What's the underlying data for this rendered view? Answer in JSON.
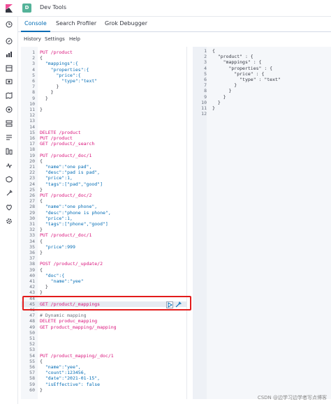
{
  "header": {
    "badge": "D",
    "title": "Dev Tools"
  },
  "tabs": [
    {
      "label": "Console"
    },
    {
      "label": "Search Profiler"
    },
    {
      "label": "Grok Debugger"
    }
  ],
  "toolbar": {
    "history": "History",
    "settings": "Settings",
    "help": "Help"
  },
  "editor_lines": [
    {
      "n": "1",
      "t": "PUT /product"
    },
    {
      "n": "2",
      "t": "{"
    },
    {
      "n": "3",
      "t": "  \"mappings\":{"
    },
    {
      "n": "4",
      "t": "    \"properties\":{"
    },
    {
      "n": "5",
      "t": "      \"price\":{"
    },
    {
      "n": "6",
      "t": "        \"type\":\"text\""
    },
    {
      "n": "7",
      "t": "      }"
    },
    {
      "n": "8",
      "t": "    }"
    },
    {
      "n": "9",
      "t": "  }"
    },
    {
      "n": "10",
      "t": ""
    },
    {
      "n": "11",
      "t": "}"
    },
    {
      "n": "12",
      "t": ""
    },
    {
      "n": "13",
      "t": ""
    },
    {
      "n": "14",
      "t": ""
    },
    {
      "n": "15",
      "t": "DELETE /product"
    },
    {
      "n": "16",
      "t": "PUT /product"
    },
    {
      "n": "17",
      "t": "GET /product/_search"
    },
    {
      "n": "18",
      "t": ""
    },
    {
      "n": "19",
      "t": "PUT /product/_doc/1"
    },
    {
      "n": "20",
      "t": "{"
    },
    {
      "n": "21",
      "t": "  \"name\":\"one pad\","
    },
    {
      "n": "22",
      "t": "  \"desc\":\"pad is pad\","
    },
    {
      "n": "23",
      "t": "  \"price\":1,"
    },
    {
      "n": "24",
      "t": "  \"tags\":[\"pad\",\"good\"]"
    },
    {
      "n": "25",
      "t": "}"
    },
    {
      "n": "26",
      "t": "PUT /product/_doc/2"
    },
    {
      "n": "27",
      "t": "{"
    },
    {
      "n": "28",
      "t": "  \"name\":\"one phone\","
    },
    {
      "n": "29",
      "t": "  \"desc\":\"phone is phone\","
    },
    {
      "n": "30",
      "t": "  \"price\":1,"
    },
    {
      "n": "31",
      "t": "  \"tags\":[\"phone\",\"good\"]"
    },
    {
      "n": "32",
      "t": "}"
    },
    {
      "n": "33",
      "t": "PUT /product/_doc/1"
    },
    {
      "n": "34",
      "t": "{"
    },
    {
      "n": "35",
      "t": "  \"price\":999"
    },
    {
      "n": "36",
      "t": "}"
    },
    {
      "n": "37",
      "t": ""
    },
    {
      "n": "38",
      "t": "POST /product/_update/2"
    },
    {
      "n": "39",
      "t": "{"
    },
    {
      "n": "40",
      "t": "  \"doc\":{"
    },
    {
      "n": "41",
      "t": "    \"name\":\"yee\""
    },
    {
      "n": "42",
      "t": "  }"
    },
    {
      "n": "43",
      "t": "}"
    },
    {
      "n": "44",
      "t": ""
    },
    {
      "n": "45",
      "t": "GET /product/_mappings"
    },
    {
      "n": "46",
      "t": ""
    },
    {
      "n": "47",
      "t": "# Dynamic mapping"
    },
    {
      "n": "48",
      "t": "DELETE produc_mapping"
    },
    {
      "n": "49",
      "t": "GET product_mapping/_mapping"
    },
    {
      "n": "50",
      "t": ""
    },
    {
      "n": "51",
      "t": ""
    },
    {
      "n": "52",
      "t": ""
    },
    {
      "n": "53",
      "t": ""
    },
    {
      "n": "54",
      "t": "PUT /product_mapping/_doc/1"
    },
    {
      "n": "55",
      "t": "{"
    },
    {
      "n": "56",
      "t": "  \"name\":\"yee\","
    },
    {
      "n": "57",
      "t": "  \"count\":123456,"
    },
    {
      "n": "58",
      "t": "  \"date\":\"2021-01-15\","
    },
    {
      "n": "59",
      "t": "  \"isEffective\": false"
    },
    {
      "n": "60",
      "t": "}"
    }
  ],
  "output_lines": [
    {
      "n": "1",
      "t": "{"
    },
    {
      "n": "2",
      "t": "  \"product\" : {"
    },
    {
      "n": "3",
      "t": "    \"mappings\" : {"
    },
    {
      "n": "4",
      "t": "      \"properties\" : {"
    },
    {
      "n": "5",
      "t": "        \"price\" : {"
    },
    {
      "n": "6",
      "t": "          \"type\" : \"text\""
    },
    {
      "n": "7",
      "t": "        }"
    },
    {
      "n": "8",
      "t": "      }"
    },
    {
      "n": "9",
      "t": "    }"
    },
    {
      "n": "10",
      "t": "  }"
    },
    {
      "n": "11",
      "t": "}"
    },
    {
      "n": "12",
      "t": ""
    }
  ],
  "watermark": "CSDN @边学习边学者写点博客"
}
